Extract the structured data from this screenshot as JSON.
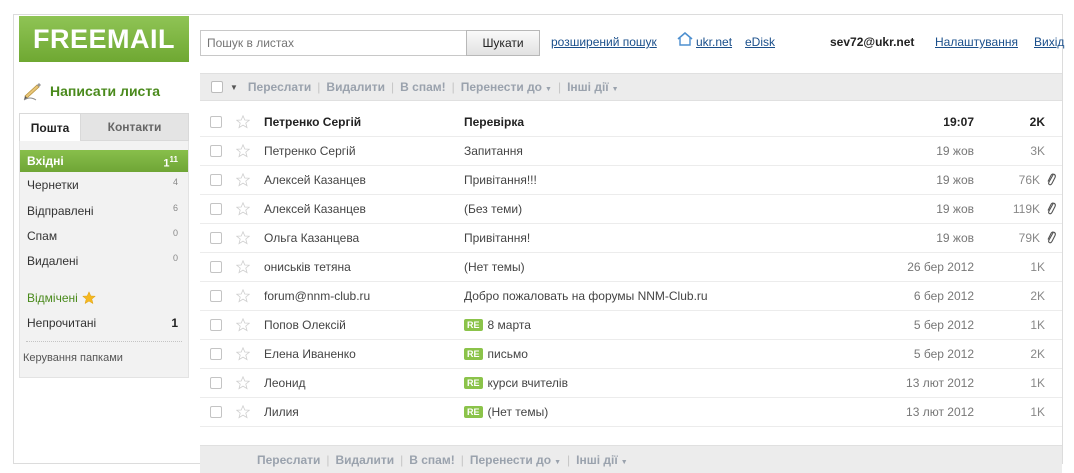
{
  "logo": "FREEMAIL",
  "search": {
    "placeholder": "Пошук в листах",
    "button": "Шукати"
  },
  "links": {
    "advanced": "розширений пошук",
    "home": "ukr.net",
    "edisk": "eDisk",
    "settings": "Налаштування",
    "logout": "Вихід"
  },
  "user": "sev72@ukr.net",
  "compose": "Написати листа",
  "tabs": {
    "mail": "Пошта",
    "contacts": "Контакти"
  },
  "folders": [
    {
      "label": "Вхідні",
      "count": "1",
      "total": "11"
    },
    {
      "label": "Чернетки",
      "count": "4"
    },
    {
      "label": "Відправлені",
      "count": "6"
    },
    {
      "label": "Спам",
      "count": "0"
    },
    {
      "label": "Видалені",
      "count": "0"
    }
  ],
  "marked": "Відмічені",
  "unread": {
    "label": "Непрочитані",
    "count": "1"
  },
  "manage_folders": "Керування папками",
  "toolbar": {
    "forward": "Переслати",
    "delete": "Видалити",
    "spam": "В спам!",
    "move": "Перенести до",
    "other": "Інші дії"
  },
  "re_badge": "RE",
  "messages": [
    {
      "from": "Петренко Сергій",
      "subject": "Перевірка",
      "date": "19:07",
      "size": "2K",
      "unread": true,
      "re": false,
      "clip": false
    },
    {
      "from": "Петренко Сергій",
      "subject": "Запитання",
      "date": "19 жов",
      "size": "3K",
      "unread": false,
      "re": false,
      "clip": false
    },
    {
      "from": "Алексей Казанцев",
      "subject": "Привітання!!!",
      "date": "19 жов",
      "size": "76K",
      "unread": false,
      "re": false,
      "clip": true
    },
    {
      "from": "Алексей Казанцев",
      "subject": "(Без теми)",
      "date": "19 жов",
      "size": "119K",
      "unread": false,
      "re": false,
      "clip": true
    },
    {
      "from": "Ольга Казанцева",
      "subject": "Привітання!",
      "date": "19 жов",
      "size": "79K",
      "unread": false,
      "re": false,
      "clip": true
    },
    {
      "from": "ониськів тетяна",
      "subject": "(Нет темы)",
      "date": "26 бер 2012",
      "size": "1K",
      "unread": false,
      "re": false,
      "clip": false
    },
    {
      "from": "forum@nnm-club.ru",
      "subject": "Добро пожаловать на форумы NNM-Club.ru",
      "date": "6 бер 2012",
      "size": "2K",
      "unread": false,
      "re": false,
      "clip": false
    },
    {
      "from": "Попов Олексій",
      "subject": "8 марта",
      "date": "5 бер 2012",
      "size": "1K",
      "unread": false,
      "re": true,
      "clip": false
    },
    {
      "from": "Елена Иваненко",
      "subject": "письмо",
      "date": "5 бер 2012",
      "size": "2K",
      "unread": false,
      "re": true,
      "clip": false
    },
    {
      "from": "Леонид",
      "subject": "курси вчителів",
      "date": "13 лют 2012",
      "size": "1K",
      "unread": false,
      "re": true,
      "clip": false
    },
    {
      "from": "Лилия",
      "subject": "(Нет темы)",
      "date": "13 лют 2012",
      "size": "1K",
      "unread": false,
      "re": true,
      "clip": false
    }
  ],
  "colors": {
    "brand": "#7bb23e",
    "link": "#1a4f8b",
    "toolbar_text": "#9aa2ad"
  }
}
